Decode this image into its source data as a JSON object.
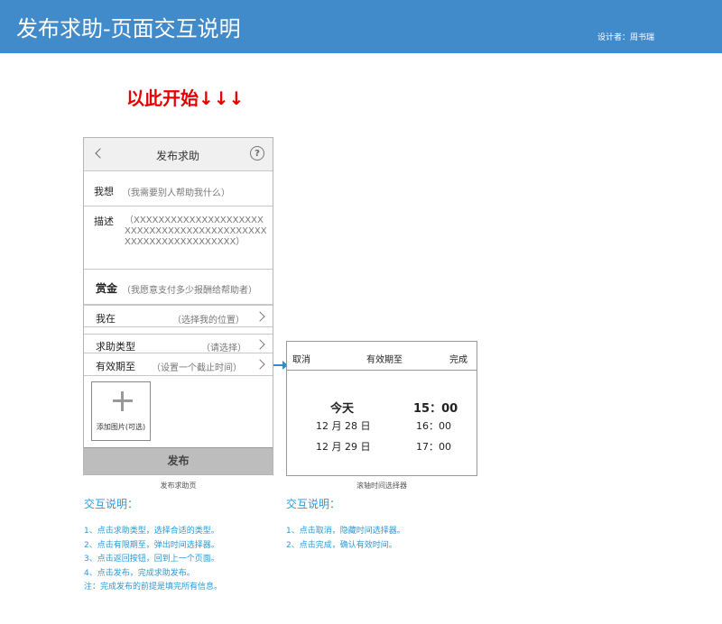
{
  "header": {
    "title": "发布求助-页面交互说明",
    "designer": "设计者：周书瑞"
  },
  "start_hint": "以此开始↓↓↓",
  "phone": {
    "nav_title": "发布求助",
    "help_icon": "?",
    "want_label": "我想",
    "want_placeholder": "（我需要别人帮助我什么）",
    "desc_label": "描述",
    "desc_placeholder": "（XXXXXXXXXXXXXXXXXXXXXXXXXXXXXXXXXXXXXXXXXXXXXXXXXXXXXXXXXXXXXX）",
    "reward_label": "赏金",
    "reward_placeholder": "（我愿意支付多少报酬给帮助者）",
    "location_label": "我在",
    "location_value": "（选择我的位置）",
    "type_label": "求助类型",
    "type_value": "（请选择）",
    "expire_label": "有效期至",
    "expire_value": "（设置一个截止时间）",
    "add_image_label": "添加图片(可选)",
    "publish_label": "发布",
    "caption": "发布求助页"
  },
  "picker": {
    "cancel": "取消",
    "title": "有效期至",
    "done": "完成",
    "rows": [
      {
        "date": "今天",
        "time": "15：00"
      },
      {
        "date": "12 月 28 日",
        "time": "16：00"
      },
      {
        "date": "12 月 29 日",
        "time": "17：00"
      }
    ],
    "caption": "滚轴时间选择器"
  },
  "notes_left": {
    "title": "交互说明：",
    "lines": [
      "1、点击求助类型，选择合适的类型。",
      "2、点击有限期至，弹出时间选择器。",
      "3、点击返回按钮，回到上一个页面。",
      "4、点击发布，完成求助发布。",
      "注：完成发布的前提是填完所有信息。"
    ]
  },
  "notes_right": {
    "title": "交互说明：",
    "lines": [
      "1、点击取消，隐藏时间选择器。",
      "2、点击完成，确认有效时间。"
    ]
  },
  "colors": {
    "header": "#428bca",
    "hint": "#e60000",
    "note": "#2a9ad8",
    "publish": "#bdbdbd"
  },
  "icons": {
    "back": "chevron-left-icon",
    "help": "help-circle-icon",
    "add_image": "plus-icon",
    "row": "chevron-right-icon",
    "link": "arrow-right-icon"
  }
}
